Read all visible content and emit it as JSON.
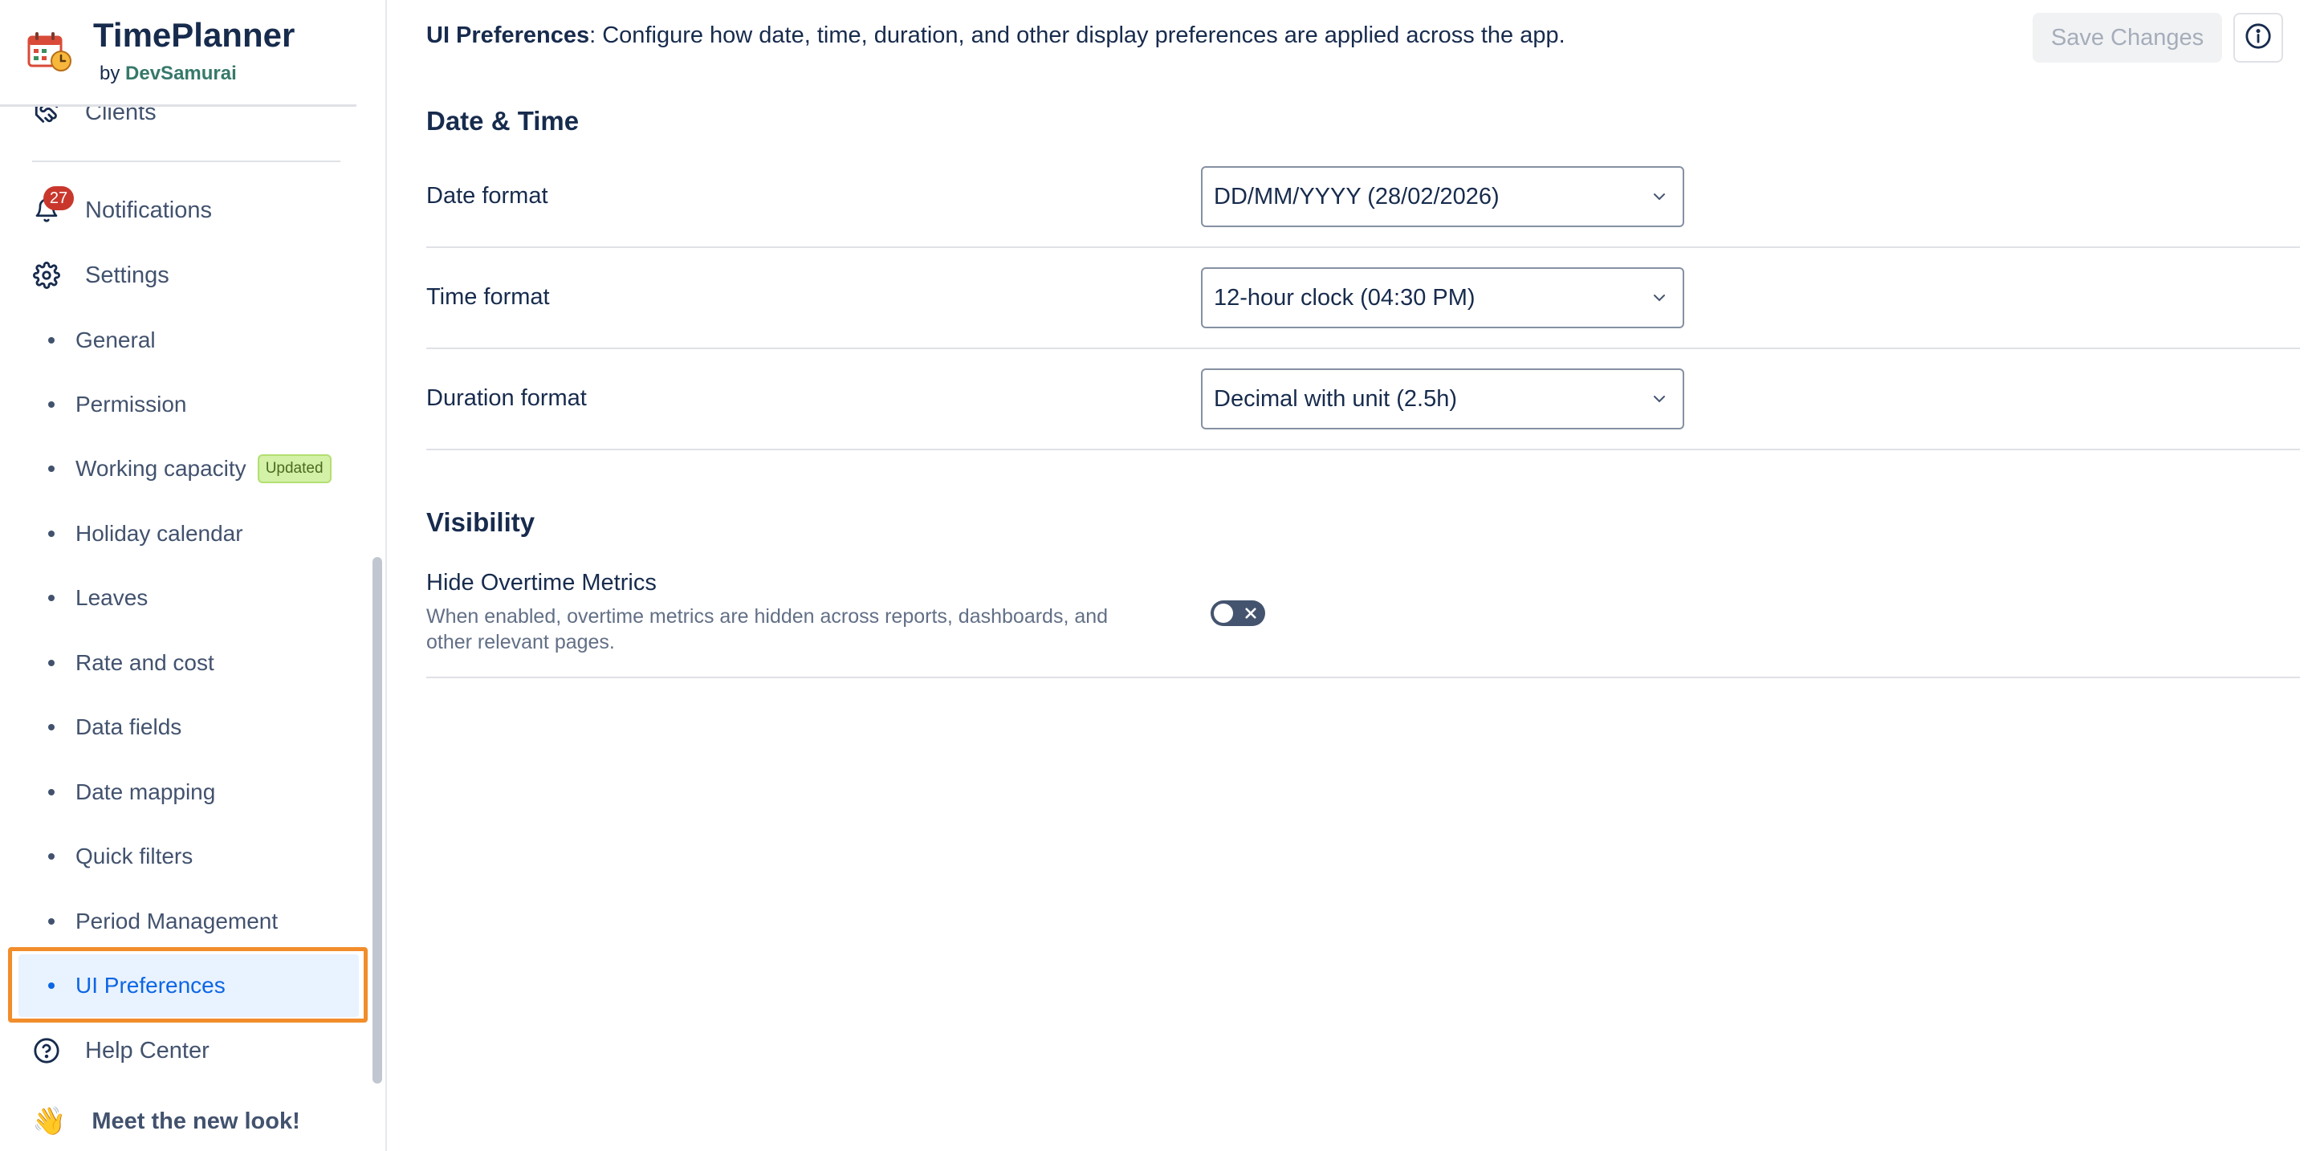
{
  "app": {
    "title": "TimePlanner",
    "by_prefix": "by",
    "by_name": "DevSamurai"
  },
  "sidebar": {
    "clients_label": "Clients",
    "notifications_label": "Notifications",
    "notifications_count": "27",
    "settings_label": "Settings",
    "sub_items": [
      {
        "label": "General"
      },
      {
        "label": "Permission"
      },
      {
        "label": "Working capacity",
        "tag": "Updated"
      },
      {
        "label": "Holiday calendar"
      },
      {
        "label": "Leaves"
      },
      {
        "label": "Rate and cost"
      },
      {
        "label": "Data fields"
      },
      {
        "label": "Date mapping"
      },
      {
        "label": "Quick filters"
      },
      {
        "label": "Period Management"
      },
      {
        "label": "UI Preferences"
      }
    ],
    "help_label": "Help Center",
    "meet_label": "Meet the new look!",
    "meet_emoji": "👋"
  },
  "header": {
    "title": "UI Preferences",
    "description": ": Configure how date, time, duration, and other display preferences are applied across the app.",
    "save_label": "Save Changes"
  },
  "date_time": {
    "section_title": "Date & Time",
    "rows": [
      {
        "label": "Date format",
        "value": "DD/MM/YYYY (28/02/2026)"
      },
      {
        "label": "Time format",
        "value": "12-hour clock (04:30 PM)"
      },
      {
        "label": "Duration format",
        "value": "Decimal with unit (2.5h)"
      }
    ]
  },
  "visibility": {
    "section_title": "Visibility",
    "hide_overtime_label": "Hide Overtime Metrics",
    "hide_overtime_desc": "When enabled, overtime metrics are hidden across reports, dashboards, and other relevant pages.",
    "hide_overtime_enabled": false
  },
  "colors": {
    "accent": "#0c66e4",
    "highlight_border": "#f18d2a",
    "badge": "#c9372c"
  }
}
